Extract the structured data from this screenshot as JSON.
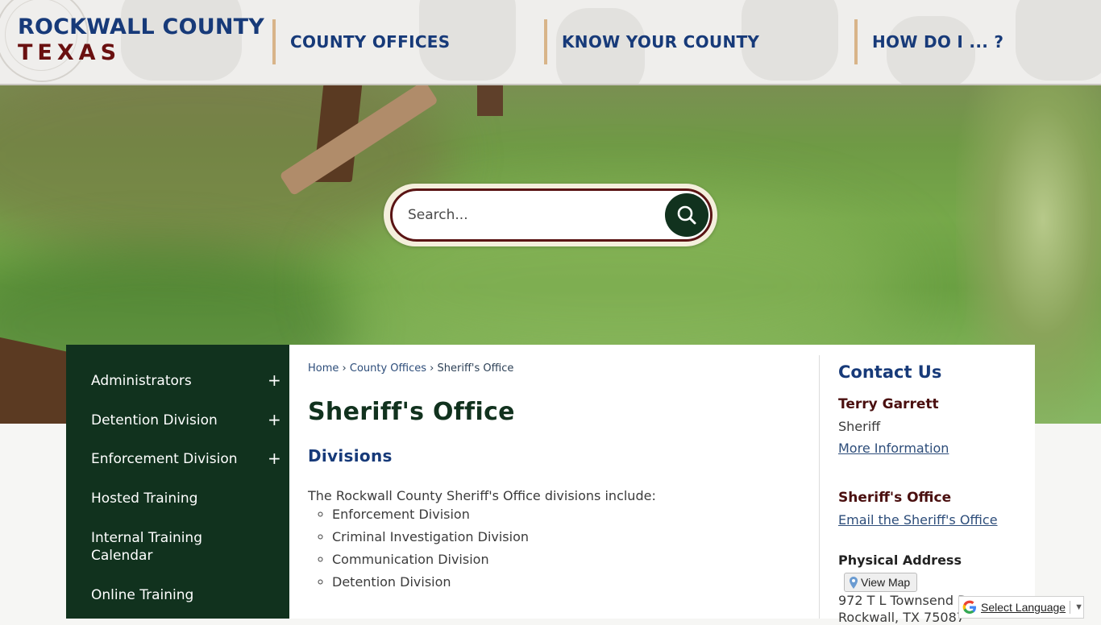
{
  "header": {
    "logo_top": "ROCKWALL COUNTY",
    "logo_bottom": "TEXAS",
    "nav": [
      "COUNTY OFFICES",
      "KNOW YOUR COUNTY",
      "HOW DO I ... ?"
    ]
  },
  "search": {
    "placeholder": "Search..."
  },
  "sidebar": {
    "items": [
      {
        "label": "Administrators",
        "expand": "+"
      },
      {
        "label": "Detention Division",
        "expand": "+"
      },
      {
        "label": "Enforcement Division",
        "expand": "+"
      },
      {
        "label": "Hosted Training"
      },
      {
        "label": "Internal Training Calendar"
      },
      {
        "label": "Online Training"
      }
    ]
  },
  "breadcrumb": {
    "home": "Home",
    "sep": "›",
    "level1": "County Offices",
    "current": "Sheriff's Office"
  },
  "main": {
    "title": "Sheriff's Office",
    "section_title": "Divisions",
    "intro": "The Rockwall County Sheriff's Office divisions include:",
    "divisions": [
      "Enforcement Division",
      "Criminal Investigation Division",
      "Communication Division",
      "Detention Division"
    ]
  },
  "contact": {
    "heading": "Contact Us",
    "name": "Terry Garrett",
    "role": "Sheriff",
    "more_info": "More Information",
    "office": "Sheriff's Office",
    "email": "Email the Sheriff's Office",
    "address_heading": "Physical Address",
    "view_map": "View Map",
    "address_line1": "972 T L Townsend Dr",
    "address_line2": "Rockwall, TX 75087"
  },
  "translate": {
    "label": "Select Language",
    "arrow": "▼"
  },
  "colors": {
    "navy": "#173a79",
    "maroon": "#6a1010",
    "forest": "#11321e",
    "tan": "#d8b489"
  }
}
